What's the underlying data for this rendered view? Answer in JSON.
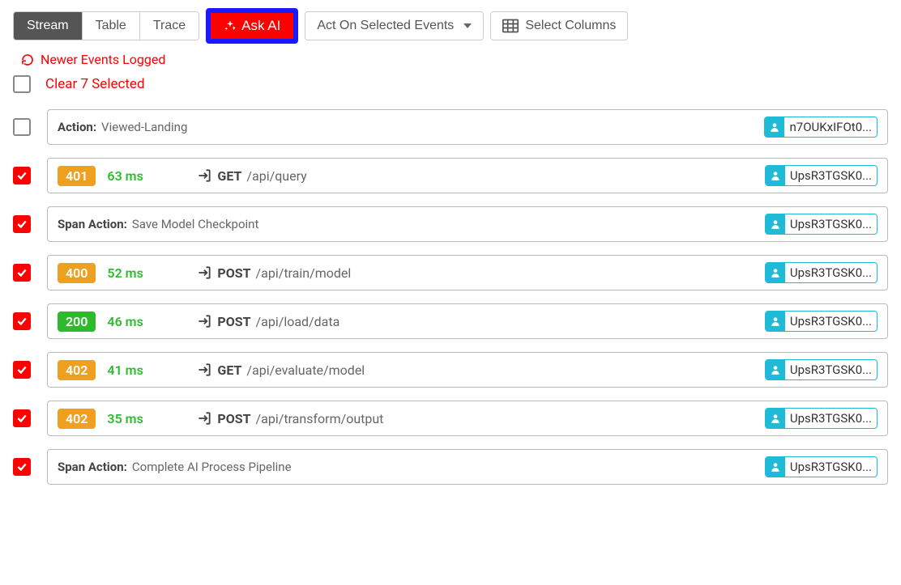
{
  "toolbar": {
    "tabs": [
      "Stream",
      "Table",
      "Trace"
    ],
    "activeTab": 0,
    "askAi": "Ask AI",
    "actOn": "Act On Selected Events",
    "selectColumns": "Select Columns"
  },
  "refresh": {
    "label": "Newer Events Logged"
  },
  "clear": {
    "label": "Clear 7 Selected"
  },
  "events": [
    {
      "checked": false,
      "type": "action",
      "actionLabel": "Action:",
      "actionText": "Viewed-Landing",
      "user": "n7OUKxIFOt0..."
    },
    {
      "checked": true,
      "type": "http",
      "status": "401",
      "statusColor": "orange",
      "duration": "63 ms",
      "method": "GET",
      "path": "/api/query",
      "user": "UpsR3TGSK0..."
    },
    {
      "checked": true,
      "type": "action",
      "actionLabel": "Span Action:",
      "actionText": "Save Model Checkpoint",
      "user": "UpsR3TGSK0..."
    },
    {
      "checked": true,
      "type": "http",
      "status": "400",
      "statusColor": "orange",
      "duration": "52 ms",
      "method": "POST",
      "path": "/api/train/model",
      "user": "UpsR3TGSK0..."
    },
    {
      "checked": true,
      "type": "http",
      "status": "200",
      "statusColor": "green",
      "duration": "46 ms",
      "method": "POST",
      "path": "/api/load/data",
      "user": "UpsR3TGSK0..."
    },
    {
      "checked": true,
      "type": "http",
      "status": "402",
      "statusColor": "orange",
      "duration": "41 ms",
      "method": "GET",
      "path": "/api/evaluate/model",
      "user": "UpsR3TGSK0..."
    },
    {
      "checked": true,
      "type": "http",
      "status": "402",
      "statusColor": "orange",
      "duration": "35 ms",
      "method": "POST",
      "path": "/api/transform/output",
      "user": "UpsR3TGSK0..."
    },
    {
      "checked": true,
      "type": "action",
      "actionLabel": "Span Action:",
      "actionText": "Complete AI Process Pipeline",
      "user": "UpsR3TGSK0..."
    }
  ]
}
